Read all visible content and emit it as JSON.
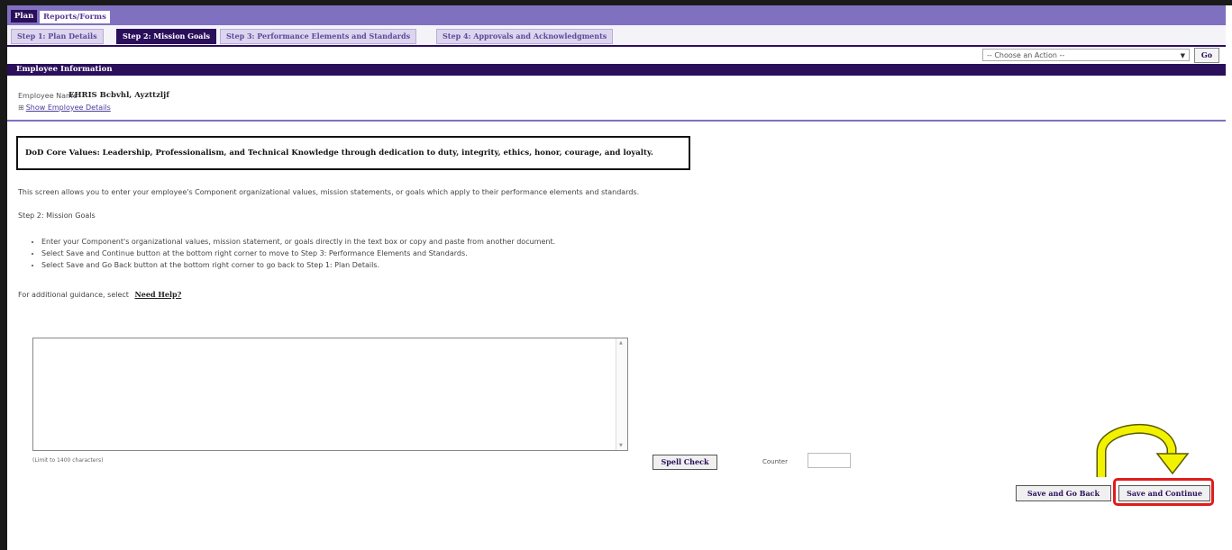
{
  "nav": {
    "plan_tab": "Plan",
    "reports_tab": "Reports/Forms"
  },
  "steps": [
    {
      "label": "Step 1: Plan Details"
    },
    {
      "label": "Step 2: Mission Goals"
    },
    {
      "label": "Step 3: Performance Elements and Standards"
    },
    {
      "label": "Step 4: Approvals and Acknowledgments"
    }
  ],
  "actions": {
    "select_value": "-- Choose an Action --",
    "go_label": "Go"
  },
  "employee": {
    "section_title": "Employee Information",
    "name_label": "Employee Name",
    "name_value": "EHRIS Bcbvhl, Ayzttzljf",
    "show_details": "Show Employee Details"
  },
  "content": {
    "core_values": "DoD Core Values: Leadership, Professionalism, and Technical Knowledge through dedication to duty, integrity, ethics, honor, courage, and loyalty.",
    "intro": "This screen allows you to enter your employee's Component organizational values, mission statements, or goals which apply to their performance elements and standards.",
    "step_title": "Step 2: Mission Goals",
    "bullets": [
      "Enter your Component's organizational values, mission statement, or goals directly in the text box or copy and paste from another document.",
      "Select Save and Continue button at the bottom right corner to move to Step 3: Performance Elements and Standards.",
      "Select Save and Go Back button at the bottom right corner to go back to Step 1: Plan Details."
    ],
    "guidance_prefix": "For additional guidance, select",
    "need_help": "Need Help?",
    "textarea_value": "",
    "limit_note": "(Limit to 1400 characters)",
    "spell_check": "Spell Check",
    "counter_label": "Counter",
    "counter_value": "",
    "save_back": "Save and Go Back",
    "save_continue": "Save and Continue"
  },
  "colors": {
    "brand": "#2a0f5a",
    "nav": "#8070c0",
    "highlight": "#e01b1b",
    "arrow": "#f2f200"
  }
}
